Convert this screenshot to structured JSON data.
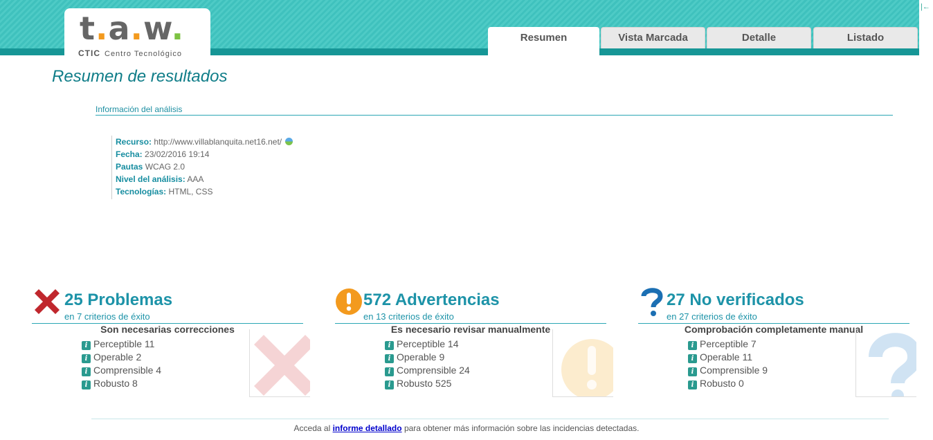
{
  "logo": {
    "text_t": "t",
    "text_a": "a",
    "text_w": "w",
    "dot": ".",
    "sub_bold": "CTIC",
    "sub": "Centro Tecnológico"
  },
  "tabs": [
    {
      "label": "Resumen",
      "active": true
    },
    {
      "label": "Vista Marcada",
      "active": false
    },
    {
      "label": "Detalle",
      "active": false
    },
    {
      "label": "Listado",
      "active": false
    }
  ],
  "collapse_glyph": "|←",
  "page_title": "Resumen de resultados",
  "analysis_section": "Información del análisis",
  "analysis": {
    "resource_label": "Recurso:",
    "resource_value": "http://www.villablanquita.net16.net/",
    "date_label": "Fecha:",
    "date_value": "23/02/2016 19:14",
    "guidelines_label": "Pautas",
    "guidelines_value": "WCAG 2.0",
    "level_label": "Nivel del análisis:",
    "level_value": "AAA",
    "tech_label": "Tecnologías:",
    "tech_value": "HTML, CSS"
  },
  "summary": {
    "problems": {
      "title": "25 Problemas",
      "sub": "en 7 criterios de éxito",
      "caption": "Son necesarias correcciones",
      "items": [
        "Perceptible 11",
        "Operable 2",
        "Comprensible 4",
        "Robusto 8"
      ],
      "color": "#c0272d"
    },
    "warnings": {
      "title": "572 Advertencias",
      "sub": "en 13 criterios de éxito",
      "caption": "Es necesario revisar manualmente",
      "items": [
        "Perceptible 14",
        "Operable 9",
        "Comprensible 24",
        "Robusto 525"
      ],
      "color": "#f39a1e"
    },
    "unverified": {
      "title": "27 No verificados",
      "sub": "en 27 criterios de éxito",
      "caption": "Comprobación completamente manual",
      "items": [
        "Perceptible 7",
        "Operable 11",
        "Comprensible 9",
        "Robusto 0"
      ],
      "color": "#1b6fb3"
    }
  },
  "footer": {
    "before": "Acceda al",
    "link": "informe detallado",
    "after": "para obtener más información sobre las incidencias detectadas."
  }
}
